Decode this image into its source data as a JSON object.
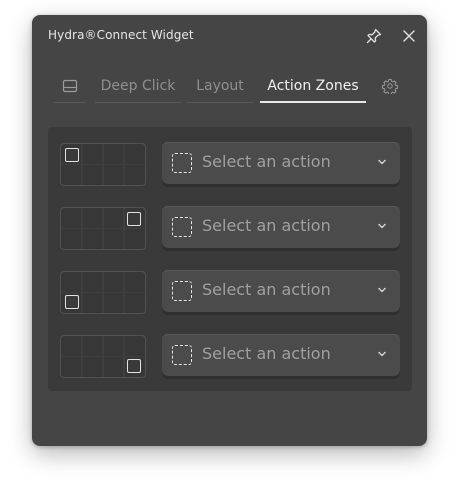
{
  "window": {
    "title": "Hydra®Connect Widget"
  },
  "icons": {
    "pin": "pin-icon",
    "close": "close-icon",
    "panel": "panel-layout-icon",
    "settings": "gear-icon",
    "zone_action": "dashed-square-icon",
    "chevron": "chevron-down-icon"
  },
  "tabs": [
    {
      "label": "Deep Click",
      "active": false
    },
    {
      "label": "Layout",
      "active": false
    },
    {
      "label": "Action Zones",
      "active": true
    }
  ],
  "action_zones": [
    {
      "zone": "top-left",
      "action_value": "",
      "placeholder": "Select an action"
    },
    {
      "zone": "top-right",
      "action_value": "",
      "placeholder": "Select an action"
    },
    {
      "zone": "bottom-left",
      "action_value": "",
      "placeholder": "Select an action"
    },
    {
      "zone": "bottom-right",
      "action_value": "",
      "placeholder": "Select an action"
    }
  ],
  "colors": {
    "window_bg": "#454545",
    "panel_bg": "#3a3a3a",
    "select_bg": "#4b4b4b",
    "active_tab": "#f0f0f0",
    "inactive_tab": "#8f8f8f"
  }
}
